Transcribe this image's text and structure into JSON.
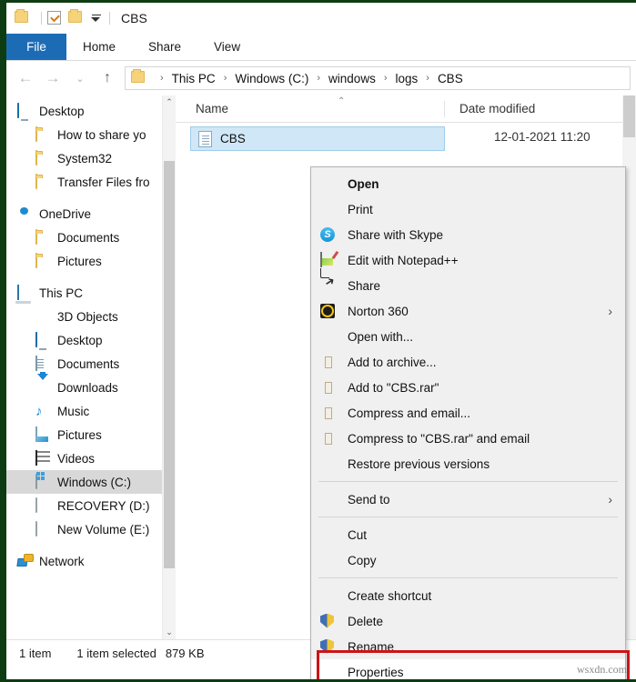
{
  "window": {
    "title": "CBS",
    "quick_access": [
      "folder-icon",
      "properties-checkbox-icon",
      "new-folder-icon",
      "customize-caret-icon"
    ]
  },
  "ribbon": {
    "tabs": [
      {
        "label": "File",
        "active": true
      },
      {
        "label": "Home",
        "active": false
      },
      {
        "label": "Share",
        "active": false
      },
      {
        "label": "View",
        "active": false
      }
    ]
  },
  "address": {
    "back": "←",
    "forward": "→",
    "history": "⌄",
    "up": "↑",
    "separator": "›",
    "breadcrumbs": [
      "This PC",
      "Windows (C:)",
      "windows",
      "logs",
      "CBS"
    ]
  },
  "sidebar": {
    "items": [
      {
        "label": "Desktop",
        "icon": "desktop-icon",
        "indent": 0,
        "selected": false
      },
      {
        "label": "How to share yo",
        "icon": "folder-icon",
        "indent": 1,
        "selected": false
      },
      {
        "label": "System32",
        "icon": "folder-icon",
        "indent": 1,
        "selected": false
      },
      {
        "label": "Transfer Files fro",
        "icon": "folder-icon",
        "indent": 1,
        "selected": false
      },
      {
        "label": "OneDrive",
        "icon": "cloud-icon",
        "indent": 0,
        "selected": false,
        "gap_before": true
      },
      {
        "label": "Documents",
        "icon": "folder-icon",
        "indent": 1,
        "selected": false
      },
      {
        "label": "Pictures",
        "icon": "folder-icon",
        "indent": 1,
        "selected": false
      },
      {
        "label": "This PC",
        "icon": "this-pc-icon",
        "indent": 0,
        "selected": false,
        "gap_before": true
      },
      {
        "label": "3D Objects",
        "icon": "3d-objects-icon",
        "indent": 1,
        "selected": false
      },
      {
        "label": "Desktop",
        "icon": "desktop-icon",
        "indent": 1,
        "selected": false
      },
      {
        "label": "Documents",
        "icon": "documents-icon",
        "indent": 1,
        "selected": false
      },
      {
        "label": "Downloads",
        "icon": "downloads-icon",
        "indent": 1,
        "selected": false
      },
      {
        "label": "Music",
        "icon": "music-icon",
        "indent": 1,
        "selected": false
      },
      {
        "label": "Pictures",
        "icon": "pictures-icon",
        "indent": 1,
        "selected": false
      },
      {
        "label": "Videos",
        "icon": "videos-icon",
        "indent": 1,
        "selected": false
      },
      {
        "label": "Windows (C:)",
        "icon": "windows-drive-icon",
        "indent": 1,
        "selected": true
      },
      {
        "label": "RECOVERY (D:)",
        "icon": "drive-icon",
        "indent": 1,
        "selected": false
      },
      {
        "label": "New Volume (E:)",
        "icon": "drive-icon",
        "indent": 1,
        "selected": false
      },
      {
        "label": "Network",
        "icon": "network-icon",
        "indent": 0,
        "selected": false,
        "gap_before": true
      }
    ],
    "scroll_up": "⌃",
    "scroll_down": "⌄"
  },
  "filepane": {
    "columns": [
      {
        "label": "Name",
        "sorted": true,
        "sort_caret": "⌃"
      },
      {
        "label": "Date modified",
        "sorted": false
      }
    ],
    "rows": [
      {
        "name": "CBS",
        "icon": "text-file-icon",
        "date": "12-01-2021 11:20",
        "selected": true
      }
    ]
  },
  "statusbar": {
    "count": "1 item",
    "selection": "1 item selected",
    "size": "879 KB"
  },
  "context_menu": {
    "items": [
      {
        "label": "Open",
        "icon": null,
        "bold": true,
        "submenu": false
      },
      {
        "label": "Print",
        "icon": null,
        "bold": false,
        "submenu": false
      },
      {
        "label": "Share with Skype",
        "icon": "skype-icon",
        "bold": false,
        "submenu": false
      },
      {
        "label": "Edit with Notepad++",
        "icon": "notepad-plus-plus-icon",
        "bold": false,
        "submenu": false
      },
      {
        "label": "Share",
        "icon": "share-icon",
        "bold": false,
        "submenu": false
      },
      {
        "label": "Norton 360",
        "icon": "norton-icon",
        "bold": false,
        "submenu": true
      },
      {
        "label": "Open with...",
        "icon": null,
        "bold": false,
        "submenu": false
      },
      {
        "label": "Add to archive...",
        "icon": "winrar-icon",
        "bold": false,
        "submenu": false
      },
      {
        "label": "Add to \"CBS.rar\"",
        "icon": "winrar-icon",
        "bold": false,
        "submenu": false
      },
      {
        "label": "Compress and email...",
        "icon": "winrar-icon",
        "bold": false,
        "submenu": false
      },
      {
        "label": "Compress to \"CBS.rar\" and email",
        "icon": "winrar-icon",
        "bold": false,
        "submenu": false
      },
      {
        "label": "Restore previous versions",
        "icon": null,
        "bold": false,
        "submenu": false
      },
      {
        "separator": true
      },
      {
        "label": "Send to",
        "icon": null,
        "bold": false,
        "submenu": true
      },
      {
        "separator": true
      },
      {
        "label": "Cut",
        "icon": null,
        "bold": false,
        "submenu": false
      },
      {
        "label": "Copy",
        "icon": null,
        "bold": false,
        "submenu": false
      },
      {
        "separator": true
      },
      {
        "label": "Create shortcut",
        "icon": null,
        "bold": false,
        "submenu": false
      },
      {
        "label": "Delete",
        "icon": "shield-icon",
        "bold": false,
        "submenu": false
      },
      {
        "label": "Rename",
        "icon": "shield-icon",
        "bold": false,
        "submenu": false
      },
      {
        "label": "Properties",
        "icon": null,
        "bold": false,
        "submenu": false,
        "highlighted": true
      }
    ],
    "submenu_chevron": "›"
  },
  "annotation": {
    "highlight_color": "#cc1418",
    "watermark": "wsxdn.com"
  }
}
